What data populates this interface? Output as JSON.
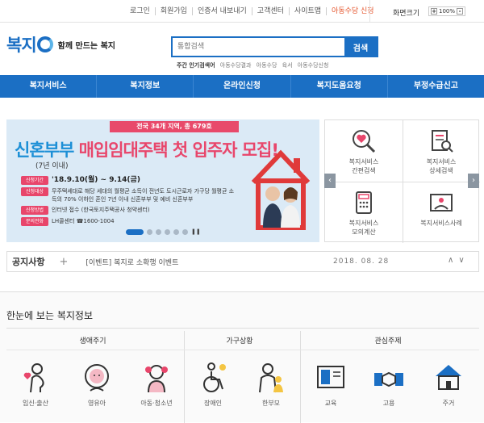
{
  "util": {
    "links": [
      "로그인",
      "회원가입",
      "인증서 내보내기",
      "고객센터",
      "사이트맵",
      "아동수당 신청"
    ],
    "zoom_label": "화면크기",
    "zoom_value": "100%",
    "zoom_plus": "+",
    "zoom_minus": "-"
  },
  "logo": {
    "mark": "복지",
    "slogan": "함께 만드는 복지"
  },
  "search": {
    "placeholder": "통합검색",
    "button": "검색",
    "popular_label": "주간 인기검색어",
    "popular": [
      "아동수당결과",
      "아동수당",
      "육서",
      "아동수당신청"
    ]
  },
  "nav": [
    "복지서비스",
    "복지정보",
    "온라인신청",
    "복지도움요청",
    "부정수급신고"
  ],
  "banner": {
    "stripe": "전국 34개 지역, 총 679호",
    "headline_blue": "신혼부부",
    "headline_pink": "매입임대주택 첫 입주자 모집!",
    "sub": "(7년 이내)",
    "rows": [
      {
        "tag": "신청기간",
        "value": "'18.9.10(월) ~ 9.14(금)"
      },
      {
        "tag": "신청대상",
        "value": "무주택세대로 해당 세대의 월평균 소득이 전년도 도시근로자 가구당 월평균 소득의 70% 이하인 혼인 7년 이내 신혼부부 및 예비 신혼부부"
      },
      {
        "tag": "신청방법",
        "value": "인터넷 접수 (한국토지주택공사 청약센터)"
      },
      {
        "tag": "문의전화",
        "value": "LH콜센터 ☎1600-1004"
      }
    ]
  },
  "quick": [
    {
      "label": "복지서비스\n간편검색",
      "icon": "heart-search-icon"
    },
    {
      "label": "복지서비스\n상세검색",
      "icon": "list-search-icon"
    },
    {
      "label": "복지서비스\n모의계산",
      "icon": "calculator-icon"
    },
    {
      "label": "복지서비스사례",
      "icon": "photo-icon"
    }
  ],
  "quick_arrows": {
    "left": "‹",
    "right": "›"
  },
  "notice": {
    "title": "공지사항",
    "plus": "+",
    "text": "[이벤트] 복지로 소확행 이벤트",
    "date": "2018. 08. 28",
    "updown": "∧∨"
  },
  "info": {
    "title": "한눈에 보는 복지정보",
    "groups": [
      "생애주기",
      "가구상황",
      "관심주제"
    ],
    "items": [
      "임신·출산",
      "영유아",
      "아동·청소년",
      "장애인",
      "한부모",
      "교육",
      "고용",
      "주거"
    ]
  },
  "colors": {
    "primary": "#1b6fc4",
    "accent": "#e8466b"
  }
}
